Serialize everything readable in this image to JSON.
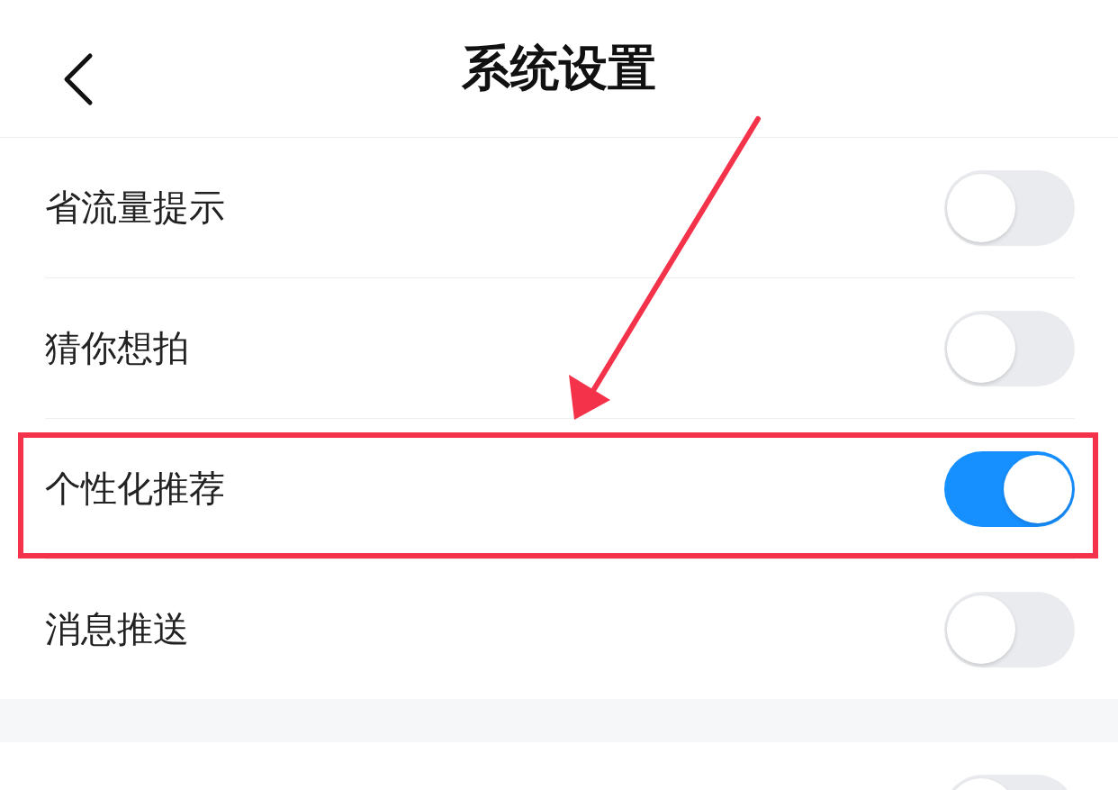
{
  "header": {
    "title": "系统设置"
  },
  "settings": [
    {
      "label": "省流量提示",
      "on": false,
      "highlighted": false
    },
    {
      "label": "猜你想拍",
      "on": false,
      "highlighted": false
    },
    {
      "label": "个性化推荐",
      "on": true,
      "highlighted": true
    },
    {
      "label": "消息推送",
      "on": false,
      "highlighted": false
    }
  ],
  "next_section": [
    {
      "on": false
    }
  ]
}
